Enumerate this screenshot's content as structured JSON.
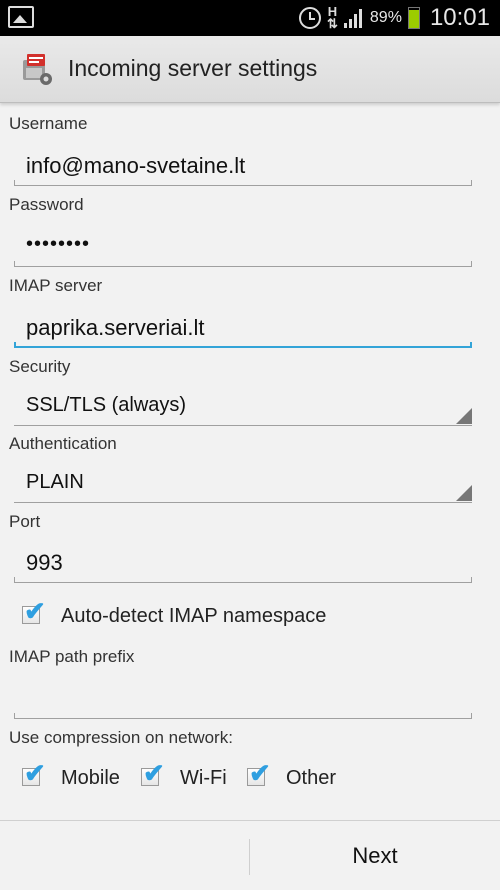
{
  "status_bar": {
    "battery_percent": "89%",
    "battery_level": 0.89,
    "time": "10:01",
    "network_type": "H",
    "icons": [
      "gallery-icon",
      "alarm-icon",
      "signal-icon",
      "battery-icon"
    ]
  },
  "header": {
    "title": "Incoming server settings",
    "icon": "mail-app-icon"
  },
  "form": {
    "username": {
      "label": "Username",
      "value": "info@mano-svetaine.lt"
    },
    "password": {
      "label": "Password",
      "value": "••••••••"
    },
    "imap_server": {
      "label": "IMAP server",
      "value": "paprika.serveriai.lt"
    },
    "security": {
      "label": "Security",
      "value": "SSL/TLS (always)"
    },
    "authentication": {
      "label": "Authentication",
      "value": "PLAIN"
    },
    "port": {
      "label": "Port",
      "value": "993"
    },
    "auto_detect": {
      "label": "Auto-detect IMAP namespace",
      "checked": true
    },
    "path_prefix": {
      "label": "IMAP path prefix",
      "value": ""
    },
    "compression": {
      "label": "Use compression on network:",
      "options": [
        {
          "label": "Mobile",
          "checked": true
        },
        {
          "label": "Wi-Fi",
          "checked": true
        },
        {
          "label": "Other",
          "checked": true
        }
      ]
    }
  },
  "footer": {
    "next_label": "Next"
  },
  "colors": {
    "accent": "#33a4d8",
    "check": "#2f9fe0",
    "battery": "#9ccc00"
  }
}
